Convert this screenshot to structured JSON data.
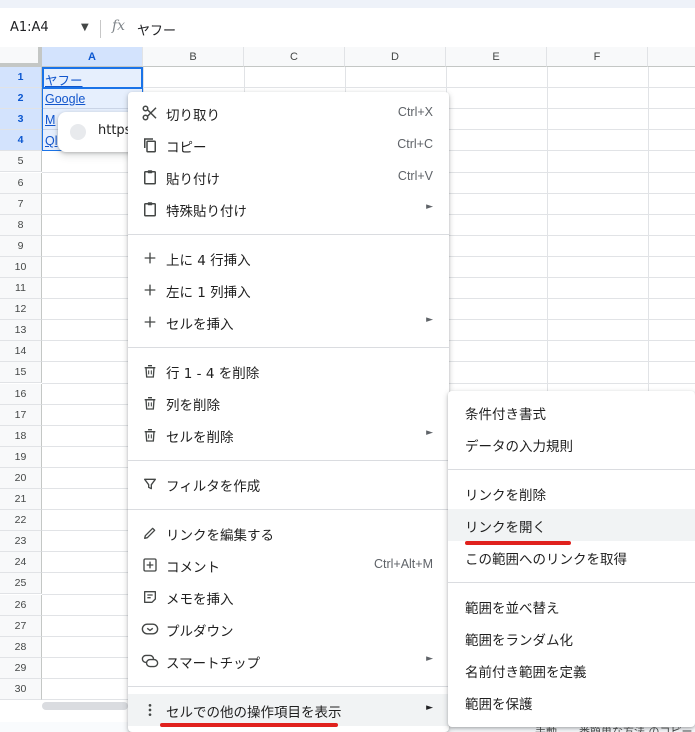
{
  "formula_bar": {
    "name_box": "A1:A4",
    "fx_label": "fx",
    "value": "ヤフー"
  },
  "columns": [
    "A",
    "B",
    "C",
    "D",
    "E",
    "F"
  ],
  "rows": [
    "1",
    "2",
    "3",
    "4",
    "5",
    "6",
    "7",
    "8",
    "9",
    "10",
    "11",
    "12",
    "13",
    "14",
    "15",
    "16",
    "17",
    "18",
    "19",
    "20",
    "21",
    "22",
    "23",
    "24",
    "25",
    "26",
    "27",
    "28",
    "29",
    "30"
  ],
  "cells": {
    "a1": "ヤフー",
    "a2": "Google",
    "a3": "M",
    "a4": "Ql"
  },
  "link_chip": {
    "text": "https"
  },
  "context_menu": {
    "items": [
      {
        "label": "切り取り",
        "shortcut": "Ctrl+X",
        "icon": "scissors-icon"
      },
      {
        "label": "コピー",
        "shortcut": "Ctrl+C",
        "icon": "copy-icon"
      },
      {
        "label": "貼り付け",
        "shortcut": "Ctrl+V",
        "icon": "clipboard-icon"
      },
      {
        "label": "特殊貼り付け",
        "icon": "clipboard-icon",
        "submenu": true
      },
      {
        "label": "上に 4 行挿入",
        "icon": "plus-icon"
      },
      {
        "label": "左に 1 列挿入",
        "icon": "plus-icon"
      },
      {
        "label": "セルを挿入",
        "icon": "plus-icon",
        "submenu": true
      },
      {
        "label": "行 1 - 4 を削除",
        "icon": "trash-icon"
      },
      {
        "label": "列を削除",
        "icon": "trash-icon"
      },
      {
        "label": "セルを削除",
        "icon": "trash-icon",
        "submenu": true
      },
      {
        "label": "フィルタを作成",
        "icon": "filter-icon"
      },
      {
        "label": "リンクを編集する",
        "icon": "pencil-icon"
      },
      {
        "label": "コメント",
        "shortcut": "Ctrl+Alt+M",
        "icon": "add-comment-icon"
      },
      {
        "label": "メモを挿入",
        "icon": "note-icon"
      },
      {
        "label": "プルダウン",
        "icon": "dropdown-chip-icon"
      },
      {
        "label": "スマートチップ",
        "icon": "smart-chip-icon",
        "submenu": true
      },
      {
        "label": "セルでの他の操作項目を表示",
        "icon": "more-vert-icon",
        "submenu": true
      }
    ],
    "arrow_glyph": "►"
  },
  "submenu": {
    "items": [
      "条件付き書式",
      "データの入力規則",
      "リンクを削除",
      "リンクを開く",
      "この範囲へのリンクを取得",
      "範囲を並べ替え",
      "範囲をランダム化",
      "名前付き範囲を定義",
      "範囲を保護"
    ]
  },
  "bottom": {
    "text": "手動　　番簡単な方法 のコピー"
  },
  "colors": {
    "selection_blue": "#1a73e8",
    "link_blue": "#1155cc",
    "highlight_red": "#e0211d"
  }
}
